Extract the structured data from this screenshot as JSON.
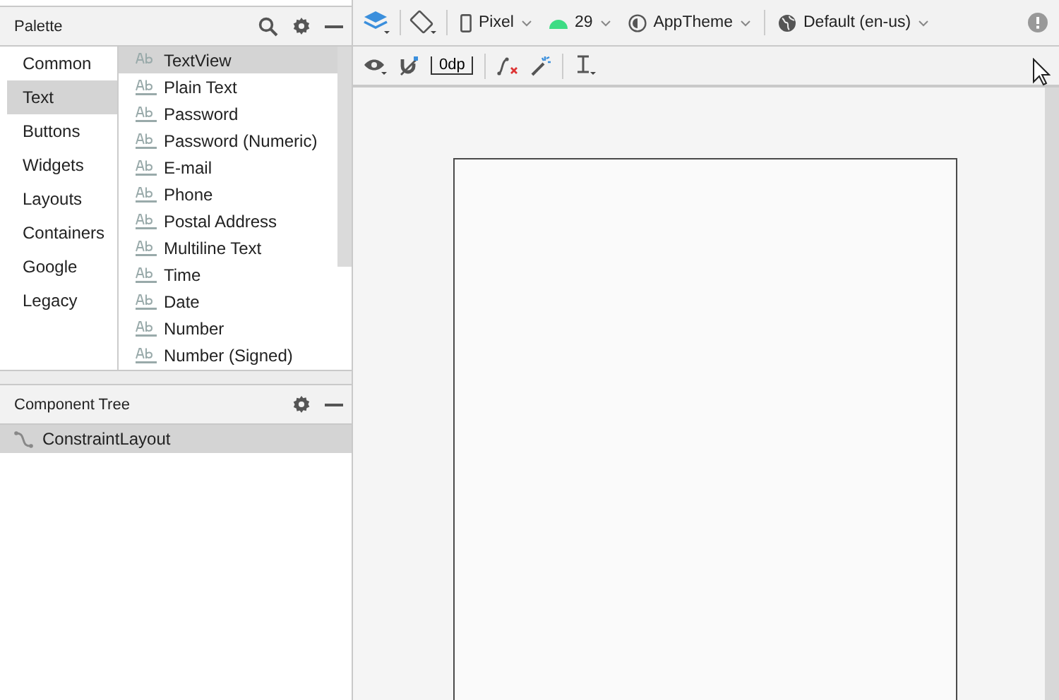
{
  "palette": {
    "title": "Palette",
    "categories": [
      {
        "label": "Common",
        "selected": false
      },
      {
        "label": "Text",
        "selected": true
      },
      {
        "label": "Buttons",
        "selected": false
      },
      {
        "label": "Widgets",
        "selected": false
      },
      {
        "label": "Layouts",
        "selected": false
      },
      {
        "label": "Containers",
        "selected": false
      },
      {
        "label": "Google",
        "selected": false
      },
      {
        "label": "Legacy",
        "selected": false
      }
    ],
    "items": [
      {
        "label": "TextView",
        "selected": true
      },
      {
        "label": "Plain Text",
        "selected": false
      },
      {
        "label": "Password",
        "selected": false
      },
      {
        "label": "Password (Numeric)",
        "selected": false
      },
      {
        "label": "E-mail",
        "selected": false
      },
      {
        "label": "Phone",
        "selected": false
      },
      {
        "label": "Postal Address",
        "selected": false
      },
      {
        "label": "Multiline Text",
        "selected": false
      },
      {
        "label": "Time",
        "selected": false
      },
      {
        "label": "Date",
        "selected": false
      },
      {
        "label": "Number",
        "selected": false
      },
      {
        "label": "Number (Signed)",
        "selected": false
      }
    ]
  },
  "component_tree": {
    "title": "Component Tree",
    "items": [
      {
        "label": "ConstraintLayout",
        "selected": true
      }
    ]
  },
  "toolbar": {
    "device": "Pixel",
    "api": "29",
    "theme": "AppTheme",
    "locale": "Default (en-us)",
    "margin": "0dp"
  }
}
